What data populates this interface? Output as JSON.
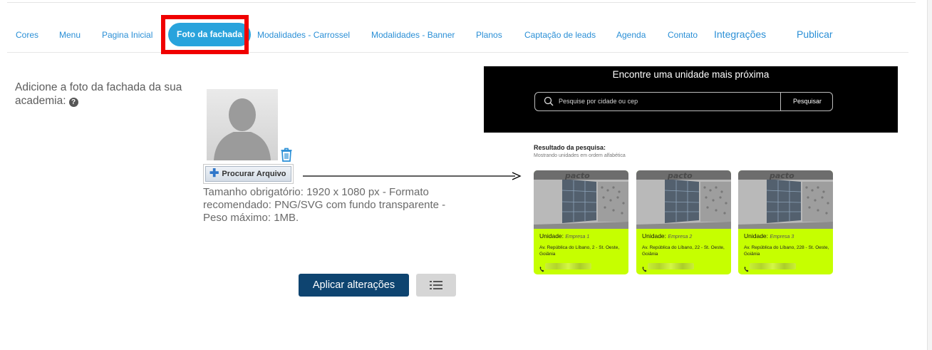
{
  "tabs": [
    {
      "label": "Cores",
      "active": false
    },
    {
      "label": "Menu",
      "active": false
    },
    {
      "label": "Pagina Inicial",
      "active": false
    },
    {
      "label": "Foto da fachada",
      "active": true
    },
    {
      "label": "Modalidades - Carrossel",
      "active": false
    },
    {
      "label": "Modalidades - Banner",
      "active": false
    },
    {
      "label": "Planos",
      "active": false
    },
    {
      "label": "Captação de leads",
      "active": false
    },
    {
      "label": "Agenda",
      "active": false
    },
    {
      "label": "Contato",
      "active": false
    },
    {
      "label": "Integrações",
      "active": false
    },
    {
      "label": "Publicar",
      "active": false
    }
  ],
  "form": {
    "label": "Adicione a foto da fachada da sua academia:",
    "help_icon": "question-circle-icon",
    "upload_button": "Procurar Arquivo",
    "hint": "Tamanho obrigatório: 1920 x 1080 px - Formato recomendado: PNG/SVG com fundo transparente - Peso máximo: 1MB.",
    "apply_button": "Aplicar alterações",
    "list_icon": "list-icon",
    "trash_icon": "trash-icon"
  },
  "preview": {
    "title": "Encontre uma unidade mais próxima",
    "search_placeholder": "Pesquise por cidade ou cep",
    "search_button": "Pesquisar",
    "results_title": "Resultado da pesquisa:",
    "results_subtitle": "Mostrando unidades em ordem alfabética",
    "brand": "pacto",
    "cards": [
      {
        "unit_label": "Unidade:",
        "unit_name": "Empresa 1",
        "address": "Av. República do Líbano, 2        - St. Oeste, Goiânia"
      },
      {
        "unit_label": "Unidade:",
        "unit_name": "Empresa 2",
        "address": "Av. República do Líbano, 22       - St. Oeste, Goiânia"
      },
      {
        "unit_label": "Unidade:",
        "unit_name": "Empresa 3",
        "address": "Av. República do Líbano, 228   - St. Oeste, Goiânia"
      }
    ]
  },
  "colors": {
    "tab_text": "#2a8fd6",
    "tab_active_bg": "#29a3dc",
    "highlight": "#f00000",
    "apply_bg": "#0e4470",
    "card_bg": "#c6ff00"
  }
}
